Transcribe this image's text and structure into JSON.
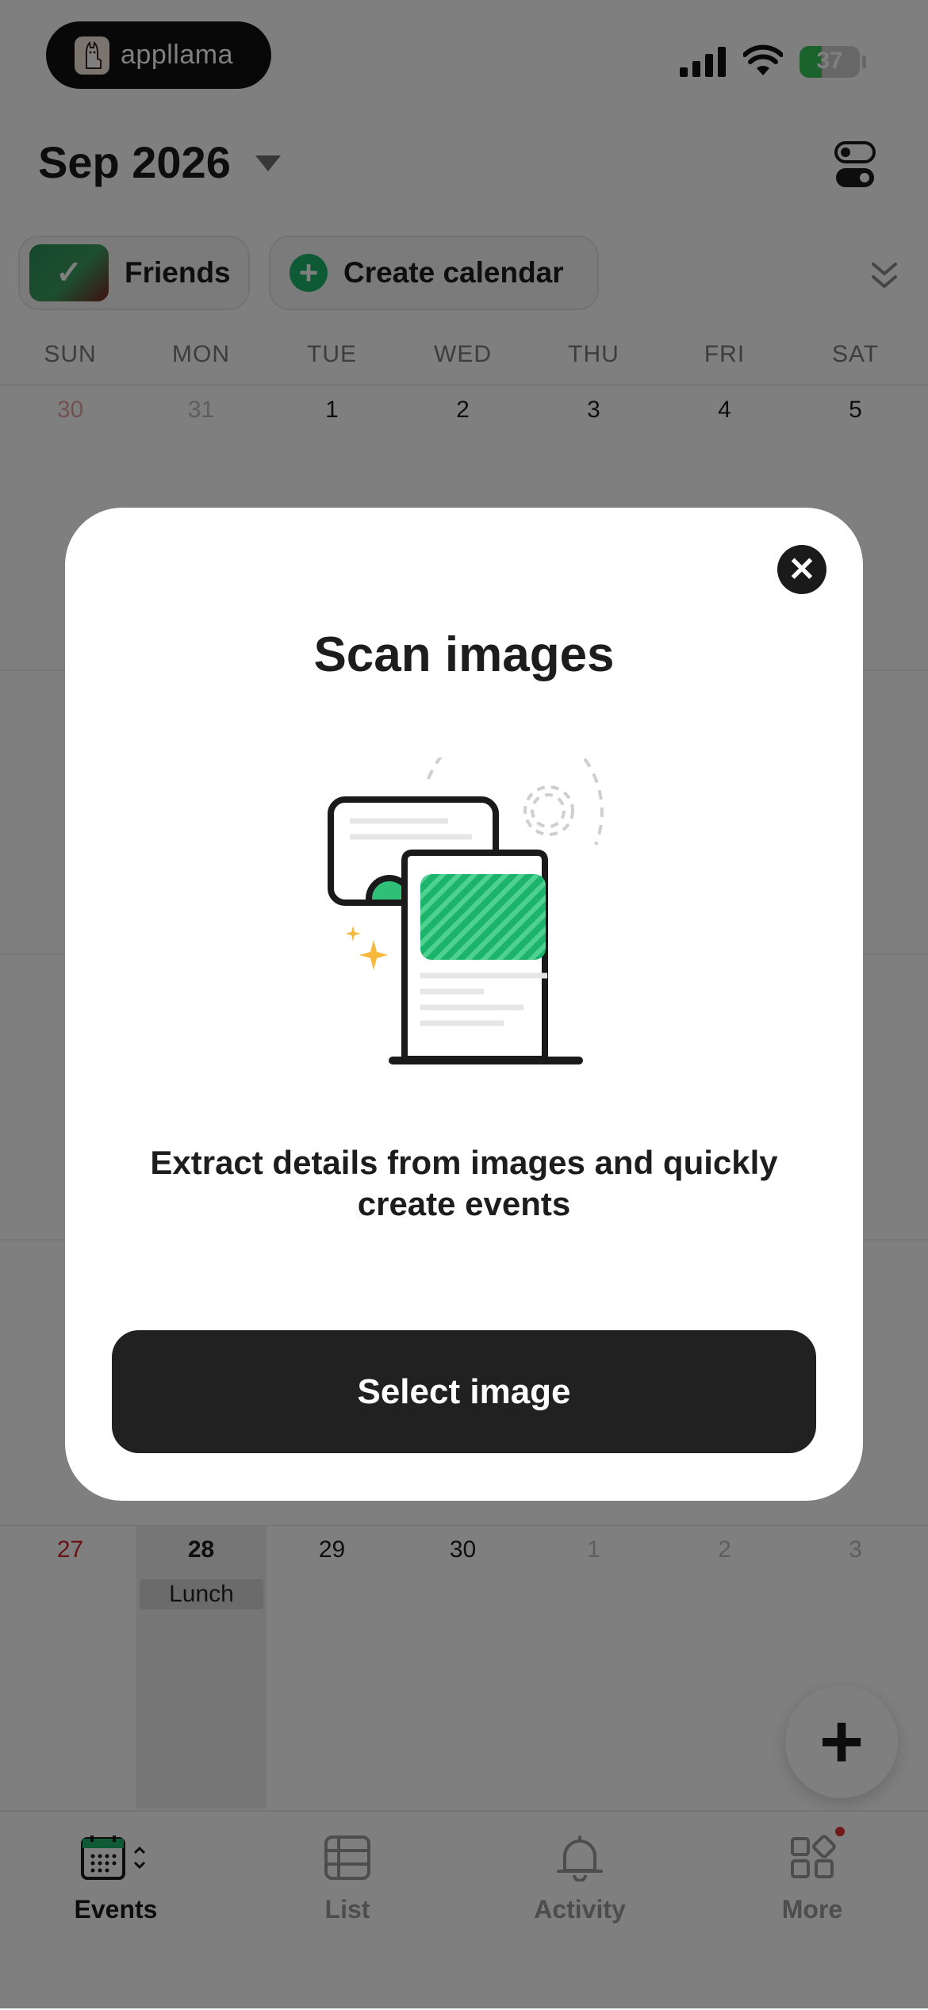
{
  "status_bar": {
    "app_badge": "appllama",
    "battery_percent": 37,
    "battery_label": "37"
  },
  "header": {
    "month_title": "Sep 2026"
  },
  "chips": {
    "friends_label": "Friends",
    "create_label": "Create calendar"
  },
  "weekdays": [
    "SUN",
    "MON",
    "TUE",
    "WED",
    "THU",
    "FRI",
    "SAT"
  ],
  "calendar": {
    "week1": [
      "30",
      "31",
      "1",
      "2",
      "3",
      "4",
      "5"
    ],
    "week5": [
      "27",
      "28",
      "29",
      "30",
      "1",
      "2",
      "3"
    ],
    "event_label": "Lunch"
  },
  "tabs": [
    {
      "label": "Events",
      "icon": "calendar-icon",
      "active": true
    },
    {
      "label": "List",
      "icon": "list-icon",
      "active": false
    },
    {
      "label": "Activity",
      "icon": "bell-icon",
      "active": false
    },
    {
      "label": "More",
      "icon": "grid-icon",
      "active": false
    }
  ],
  "modal": {
    "title": "Scan images",
    "description": "Extract details from images and quickly create events",
    "button_label": "Select image"
  },
  "colors": {
    "accent_green": "#1bb46a",
    "overlay": "rgba(0,0,0,0.5)",
    "weekend_red": "#d12a2a",
    "button_dark": "#212121"
  }
}
